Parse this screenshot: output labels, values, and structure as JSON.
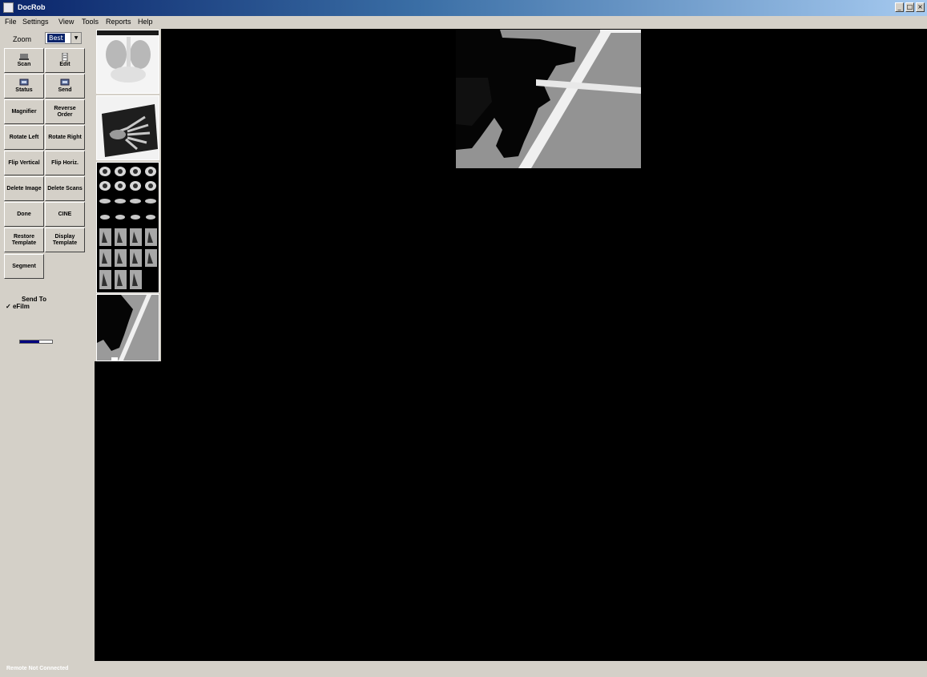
{
  "window": {
    "title": "DocRob",
    "minimize_glyph": "_",
    "maximize_glyph": "□",
    "close_glyph": "×"
  },
  "menu": [
    "File",
    "Settings",
    "View",
    "Tools",
    "Reports",
    "Help"
  ],
  "zoom": {
    "label": "Zoom",
    "value": "Best"
  },
  "tools": [
    {
      "name": "scan",
      "label": "Scan",
      "icon": "scanner-icon"
    },
    {
      "name": "edit",
      "label": "Edit",
      "icon": "edit-icon"
    },
    {
      "name": "status",
      "label": "Status",
      "icon": "status-icon"
    },
    {
      "name": "send",
      "label": "Send",
      "icon": "send-icon"
    },
    {
      "name": "magnifier",
      "label": "Magnifier",
      "icon": ""
    },
    {
      "name": "reverse-order",
      "label": "Reverse Order",
      "icon": ""
    },
    {
      "name": "rotate-left",
      "label": "Rotate Left",
      "icon": ""
    },
    {
      "name": "rotate-right",
      "label": "Rotate Right",
      "icon": ""
    },
    {
      "name": "flip-vertical",
      "label": "Flip Vertical",
      "icon": ""
    },
    {
      "name": "flip-horiz",
      "label": "Flip Horiz.",
      "icon": ""
    },
    {
      "name": "delete-image",
      "label": "Delete Image",
      "icon": ""
    },
    {
      "name": "delete-scans",
      "label": "Delete Scans",
      "icon": ""
    },
    {
      "name": "done",
      "label": "Done",
      "icon": ""
    },
    {
      "name": "cine",
      "label": "CINE",
      "icon": ""
    },
    {
      "name": "restore-template",
      "label": "Restore Template",
      "icon": ""
    },
    {
      "name": "display-template",
      "label": "Display Template",
      "icon": ""
    },
    {
      "name": "segment",
      "label": "Segment",
      "icon": ""
    }
  ],
  "send_to": {
    "label": "Send To",
    "checkbox_label": "eFilm",
    "checked": true,
    "progress": 0.6
  },
  "thumbnails": [
    {
      "name": "chest-xray-thumbnail"
    },
    {
      "name": "hand-xray-thumbnail"
    },
    {
      "name": "mri-series-thumbnail"
    },
    {
      "name": "court-photo-thumbnail"
    }
  ],
  "status_bar": {
    "text": "Remote Not Connected"
  },
  "colors": {
    "window_bg": "#d4d0c8",
    "viewer_bg": "#000000",
    "titlebar_start": "#0a246a",
    "titlebar_end": "#a6caf0"
  }
}
